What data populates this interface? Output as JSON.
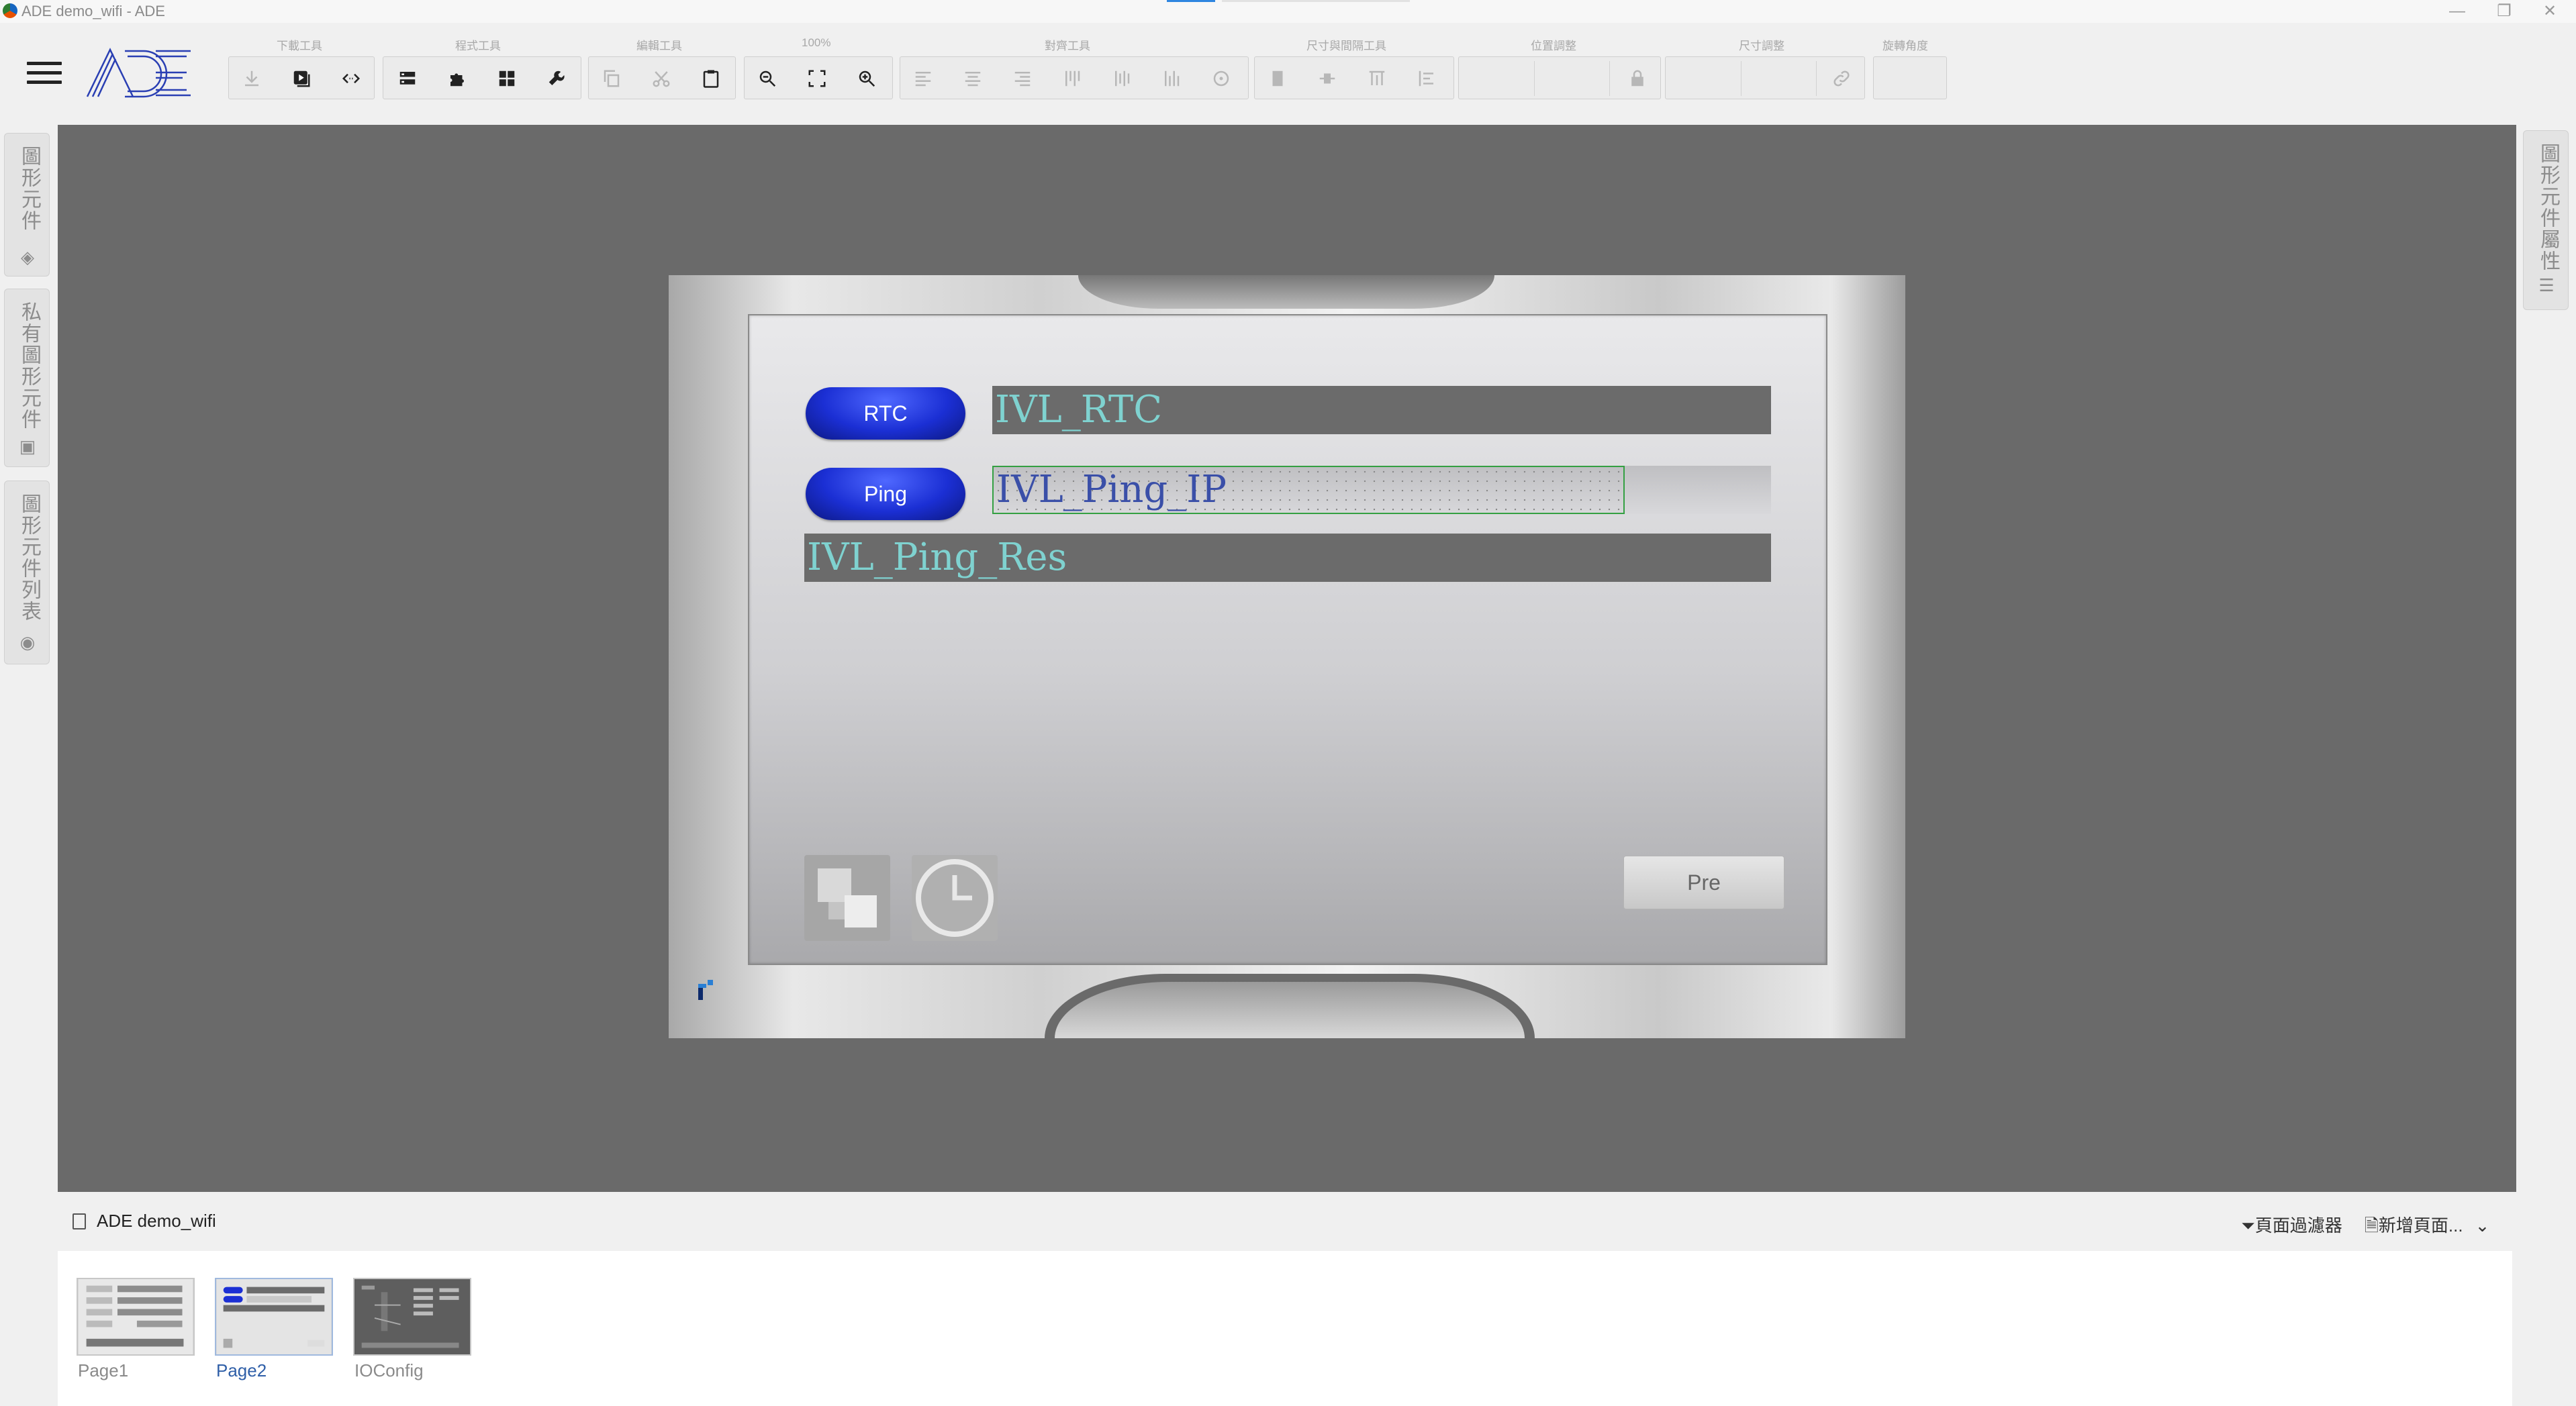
{
  "window": {
    "title": "ADE demo_wifi - ADE",
    "minimize": "—",
    "restore": "❐",
    "close": "✕"
  },
  "toolbar": {
    "groups": [
      {
        "label": "下載工具"
      },
      {
        "label": "程式工具"
      },
      {
        "label": "編輯工具"
      },
      {
        "label": "100%"
      },
      {
        "label": "對齊工具"
      },
      {
        "label": "尺寸與間隔工具"
      },
      {
        "label": "位置調整"
      },
      {
        "label": "尺寸調整"
      },
      {
        "label": "旋轉角度"
      }
    ]
  },
  "left_sidebar": {
    "tabs": [
      {
        "label": "圖形元件",
        "icon": "diamond-arrows-icon"
      },
      {
        "label": "私有圖形元件",
        "icon": "stack-icon"
      },
      {
        "label": "圖形元件列表",
        "icon": "eye-icon"
      }
    ]
  },
  "right_sidebar": {
    "tabs": [
      {
        "label": "圖形元件屬性",
        "icon": "sliders-icon"
      }
    ]
  },
  "hmi": {
    "rtc_button": "RTC",
    "rtc_field": "IVL_RTC",
    "ping_button": "Ping",
    "ping_field": "IVL_Ping_IP",
    "ping_result_field": "IVL_Ping_Res",
    "pre_button": "Pre"
  },
  "bottom_panel": {
    "project_name": "ADE demo_wifi",
    "page_filter": "頁面過濾器",
    "add_page": "新增頁面...",
    "pages": [
      {
        "name": "Page1",
        "selected": false
      },
      {
        "name": "Page2",
        "selected": true
      },
      {
        "name": "IOConfig",
        "selected": false
      }
    ]
  },
  "colors": {
    "canvas_bg": "#6a6a6a",
    "accent": "#2f86e0",
    "hmi_button": "#1b2fd4",
    "field_text": "#7fd2d0",
    "selection": "#34a043"
  }
}
